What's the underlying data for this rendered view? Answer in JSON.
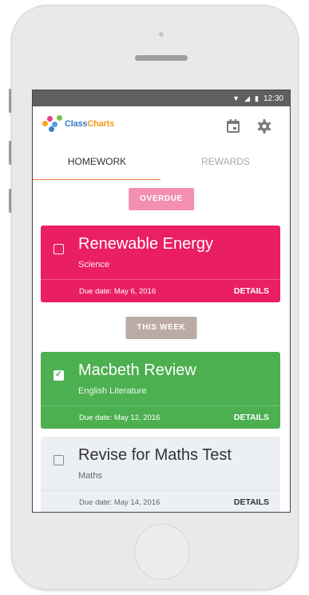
{
  "status_bar": {
    "time": "12:30",
    "wifi_icon": "wifi-icon",
    "signal_icon": "signal-icon",
    "battery_icon": "battery-icon"
  },
  "app": {
    "logo_part1": "Class",
    "logo_part2": "Charts",
    "calendar_icon": "calendar-icon",
    "settings_icon": "gear-icon"
  },
  "tabs": [
    {
      "label": "HOMEWORK",
      "active": true
    },
    {
      "label": "REWARDS",
      "active": false
    }
  ],
  "sections": [
    {
      "label": "OVERDUE",
      "color": "#f48fb1"
    },
    {
      "label": "THIS WEEK",
      "color": "#bcaaa4"
    }
  ],
  "homework": [
    {
      "title": "Renewable Energy",
      "subject": "Science",
      "due": "Due date: May 6, 2016",
      "details_label": "DETAILS",
      "checked": false,
      "color": "#ea1e63"
    },
    {
      "title": "Macbeth Review",
      "subject": "English Literature",
      "due": "Due date: May 12, 2016",
      "details_label": "DETAILS",
      "checked": true,
      "color": "#4caf50"
    },
    {
      "title": "Revise for Maths Test",
      "subject": "Maths",
      "due": "Due date: May 14, 2016",
      "details_label": "DETAILS",
      "checked": false,
      "color": "#eceff3"
    }
  ],
  "colors": {
    "accent": "#f0733a",
    "statusbar": "#5f5f5f"
  }
}
